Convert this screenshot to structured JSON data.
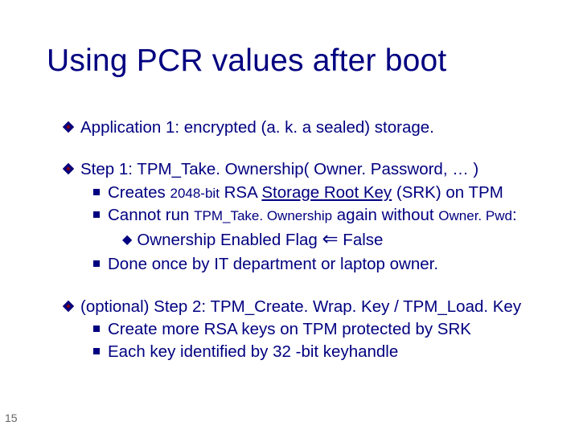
{
  "slide_number": "15",
  "title": "Using PCR values after boot",
  "app1": {
    "lead": "Application 1:   encrypted (a. k. a  sealed)  storage."
  },
  "step1": {
    "lead_a": "Step 1: ",
    "lead_b": "TPM_Take. Ownership( Owner. Password,  … )",
    "sub1_a": "Creates ",
    "sub1_b": "2048-bit",
    "sub1_c": " RSA ",
    "sub1_d": "Storage Root Key",
    "sub1_e": " (SRK) on TPM",
    "sub2_a": "Cannot run ",
    "sub2_b": "TPM_Take. Ownership",
    "sub2_c": " again without ",
    "sub2_d": "Owner. Pwd",
    "sub2_e": ":",
    "sub3_a": "Ownership Enabled Flag  ",
    "sub3_arrow": "⇐",
    "sub3_b": "    False",
    "sub4": "Done once by IT department or laptop owner."
  },
  "step2": {
    "lead_a": "(optional) Step 2:    ",
    "lead_b": "TPM_Create. Wrap. Key / TPM_Load. Key",
    "sub1": "Create more RSA keys on TPM protected by SRK",
    "sub2": "Each key identified by 32 -bit keyhandle"
  }
}
